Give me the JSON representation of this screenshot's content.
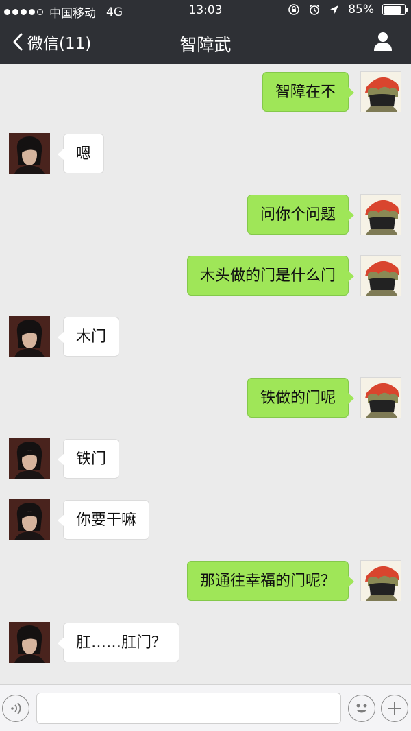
{
  "status_bar": {
    "carrier": "中国移动",
    "network": "4G",
    "time": "13:03",
    "battery": "85%",
    "battery_level": 0.85,
    "signal_bars": 4
  },
  "nav": {
    "back_label": "微信(11)",
    "title": "智障武",
    "back_icon": "chevron-left-icon",
    "profile_icon": "person-icon"
  },
  "colors": {
    "header_bg": "#2e3035",
    "chat_bg": "#ebebeb",
    "sent_bubble": "#9fe658",
    "received_bubble": "#ffffff"
  },
  "messages": [
    {
      "side": "right",
      "text": "智障在不"
    },
    {
      "side": "left",
      "text": "嗯"
    },
    {
      "side": "right",
      "text": "问你个问题"
    },
    {
      "side": "right",
      "text": "木头做的门是什么门"
    },
    {
      "side": "left",
      "text": "木门"
    },
    {
      "side": "right",
      "text": "铁做的门呢"
    },
    {
      "side": "left",
      "text": "铁门"
    },
    {
      "side": "left",
      "text": "你要干嘛"
    },
    {
      "side": "right",
      "text": "那通往幸福的门呢？"
    },
    {
      "side": "left",
      "text": "肛……肛门？"
    }
  ],
  "input_bar": {
    "voice_icon": "voice-icon",
    "emoji_icon": "emoji-icon",
    "add_icon": "plus-icon",
    "text_value": ""
  }
}
